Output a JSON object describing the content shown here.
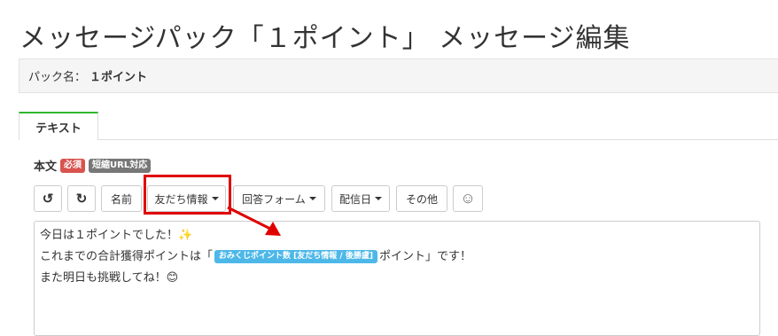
{
  "header": {
    "title": "メッセージパック「１ポイント」 メッセージ編集"
  },
  "pack": {
    "label": "パック名：",
    "value": "１ポイント"
  },
  "tabs": [
    {
      "label": "テキスト",
      "active": true
    }
  ],
  "body_section": {
    "label": "本文",
    "badges": {
      "required": "必須",
      "short_url": "短縮URL対応"
    }
  },
  "toolbar": {
    "undo_icon": "↺",
    "redo_icon": "↻",
    "name_label": "名前",
    "friend_info_label": "友だち情報",
    "answer_form_label": "回答フォーム",
    "send_date_label": "配信日",
    "other_label": "その他",
    "emoji_icon": "☺"
  },
  "editor": {
    "line1": "今日は１ポイントでした！✨",
    "line2_before": "これまでの合計獲得ポイントは「",
    "variable_tag": "おみくじポイント数 [友だち情報 / 後勝盧]",
    "line2_after": "ポイント」です！",
    "line3": "また明日も挑戦してね！😊"
  },
  "colors": {
    "tab_accent": "#2eb82e",
    "required_badge": "#d9534f",
    "short_url_badge": "#777777",
    "variable_tag": "#4db8e8",
    "highlight": "#e00000"
  }
}
